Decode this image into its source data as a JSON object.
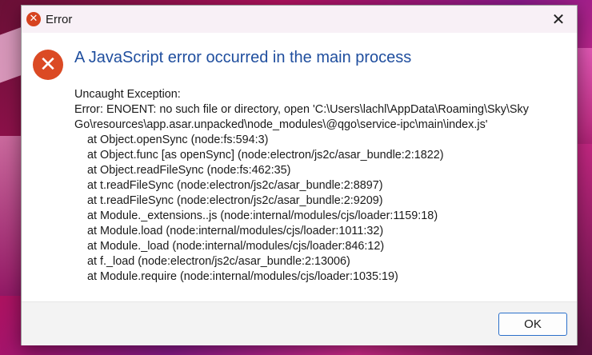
{
  "dialog": {
    "title": "Error",
    "close_glyph": "✕",
    "heading": "A JavaScript error occurred in the main process",
    "error_icon": "error-x-icon",
    "message_lines": [
      "Uncaught Exception:",
      "Error: ENOENT: no such file or directory, open 'C:\\Users\\lachl\\AppData\\Roaming\\Sky\\Sky",
      "Go\\resources\\app.asar.unpacked\\node_modules\\@qgo\\service-ipc\\main\\index.js'"
    ],
    "stack": [
      "at Object.openSync (node:fs:594:3)",
      "at Object.func [as openSync] (node:electron/js2c/asar_bundle:2:1822)",
      "at Object.readFileSync (node:fs:462:35)",
      "at t.readFileSync (node:electron/js2c/asar_bundle:2:8897)",
      "at t.readFileSync (node:electron/js2c/asar_bundle:2:9209)",
      "at Module._extensions..js (node:internal/modules/cjs/loader:1159:18)",
      "at Module.load (node:internal/modules/cjs/loader:1011:32)",
      "at Module._load (node:internal/modules/cjs/loader:846:12)",
      "at f._load (node:electron/js2c/asar_bundle:2:13006)",
      "at Module.require (node:internal/modules/cjs/loader:1035:19)"
    ],
    "ok_label": "OK"
  },
  "colors": {
    "heading": "#1f4e9e",
    "error_icon": "#db4a24",
    "button_border": "#2a6fc9"
  }
}
